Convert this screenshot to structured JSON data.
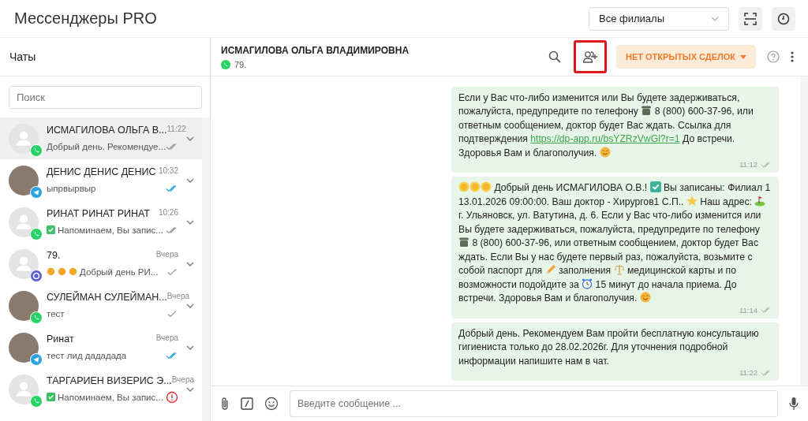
{
  "app_title": "Мессенджеры PRO",
  "branch_select": {
    "value": "Все филиалы"
  },
  "sidebar": {
    "title": "Чаты",
    "search": {
      "placeholder": "Поиск"
    },
    "chats": [
      {
        "name": "ИСМАГИЛОВА ОЛЬГА В...",
        "time": "11:22",
        "preview": [
          {
            "kind": "text",
            "text": "Добрый день. Рекомендуе..."
          }
        ],
        "channel": {
          "kind": "whatsapp"
        },
        "avatar": {
          "kind": "default"
        },
        "status": {
          "kind": "delivered"
        },
        "selected": true
      },
      {
        "name": "ДЕНИС ДЕНИС ДЕНИС",
        "time": "10:32",
        "preview": [
          {
            "kind": "text",
            "text": "ыпрвырвыр"
          }
        ],
        "channel": {
          "kind": "telegram"
        },
        "avatar": {
          "kind": "photo"
        },
        "status": {
          "kind": "read"
        },
        "selected": false
      },
      {
        "name": "РИНАТ РИНАТ РИНАТ",
        "time": "10:26",
        "preview": [
          {
            "kind": "check"
          },
          {
            "kind": "text",
            "text": "Напоминаем, Вы запис..."
          }
        ],
        "channel": {
          "kind": "whatsapp"
        },
        "avatar": {
          "kind": "default"
        },
        "status": {
          "kind": "delivered"
        },
        "selected": false
      },
      {
        "name": "79.",
        "time": "Вчера",
        "preview": [
          {
            "kind": "sun"
          },
          {
            "kind": "sun"
          },
          {
            "kind": "sun"
          },
          {
            "kind": "text",
            "text": "Добрый день РИ..."
          }
        ],
        "channel": {
          "kind": "other"
        },
        "avatar": {
          "kind": "default"
        },
        "status": {
          "kind": "sent"
        },
        "selected": false
      },
      {
        "name": "СУЛЕЙМАН СУЛЕЙМАН...",
        "time": "Вчера",
        "preview": [
          {
            "kind": "text",
            "text": "тест"
          }
        ],
        "channel": {
          "kind": "whatsapp"
        },
        "avatar": {
          "kind": "photo"
        },
        "status": {
          "kind": "sent"
        },
        "selected": false
      },
      {
        "name": "Ринат",
        "time": "Вчера",
        "preview": [
          {
            "kind": "text",
            "text": "тест лид дададада"
          }
        ],
        "channel": {
          "kind": "telegram"
        },
        "avatar": {
          "kind": "photo"
        },
        "status": {
          "kind": "read"
        },
        "selected": false
      },
      {
        "name": "ТАРГАРИЕН ВИЗЕРИС Э...",
        "time": "Вчера",
        "preview": [
          {
            "kind": "check"
          },
          {
            "kind": "text",
            "text": "Напоминаем, Вы запис..."
          }
        ],
        "channel": {
          "kind": "whatsapp"
        },
        "avatar": {
          "kind": "default"
        },
        "status": {
          "kind": "error"
        },
        "selected": false
      }
    ]
  },
  "chat": {
    "contact_name": "ИСМАГИЛОВА ОЛЬГА ВЛАДИМИРОВНА",
    "contact_phone": "79.",
    "channel": {
      "kind": "whatsapp"
    },
    "deals_button": "НЕТ ОТКРЫТЫХ СДЕЛОК",
    "messages": [
      {
        "parts": [
          {
            "kind": "text",
            "text": "Если у Вас что-либо изменится или Вы будете задерживаться, пожалуйста, предупредите по телефону "
          },
          {
            "kind": "phone"
          },
          {
            "kind": "text",
            "text": " 8 (800) 600-37-96, или ответным сообщением, доктор будет Вас ждать. Ссылка для подтверждения "
          },
          {
            "kind": "link",
            "text": "https://dp-app.ru/bsYZRzVwGl?r=1"
          },
          {
            "kind": "text",
            "text": " До встречи. Здоровья Вам и благополучия. "
          },
          {
            "kind": "smile"
          }
        ],
        "time": "11:12",
        "status": {
          "kind": "delivered"
        }
      },
      {
        "parts": [
          {
            "kind": "sun"
          },
          {
            "kind": "sun"
          },
          {
            "kind": "sun"
          },
          {
            "kind": "text",
            "text": " Добрый день ИСМАГИЛОВА О.В.! "
          },
          {
            "kind": "check"
          },
          {
            "kind": "text",
            "text": " Вы записаны: Филиал 1 13.01.2026 09:00:00. Ваш доктор - Хирургов1 С.П.. "
          },
          {
            "kind": "star"
          },
          {
            "kind": "text",
            "text": " Наш адрес: "
          },
          {
            "kind": "golf"
          },
          {
            "kind": "text",
            "text": " г. Ульяновск, ул. Ватутина, д. 6. Если у Вас что-либо изменится или Вы будете задерживаться, пожалуйста, предупредите по телефону "
          },
          {
            "kind": "phone"
          },
          {
            "kind": "text",
            "text": " 8 (800) 600-37-96, или ответным сообщением, доктор будет Вас ждать. Если Вы у нас будете первый раз, пожалуйста, возьмите с собой паспорт для "
          },
          {
            "kind": "pencil"
          },
          {
            "kind": "text",
            "text": " заполнения "
          },
          {
            "kind": "scales"
          },
          {
            "kind": "text",
            "text": " медицинской карты и по возможности подойдите за "
          },
          {
            "kind": "clock"
          },
          {
            "kind": "text",
            "text": " 15 минут до начала приема. До встречи. Здоровья Вам и благополучия. "
          },
          {
            "kind": "smile"
          }
        ],
        "time": "11:14",
        "status": {
          "kind": "delivered"
        }
      },
      {
        "parts": [
          {
            "kind": "text",
            "text": "Добрый день. Рекомендуем Вам пройти бесплатную консультацию гигиениста только до 28.02.2026г. Для уточнения подробной информации напишите нам в чат."
          }
        ],
        "time": "11:22",
        "status": {
          "kind": "delivered"
        }
      }
    ],
    "input": {
      "placeholder": "Введите сообщение ..."
    }
  }
}
